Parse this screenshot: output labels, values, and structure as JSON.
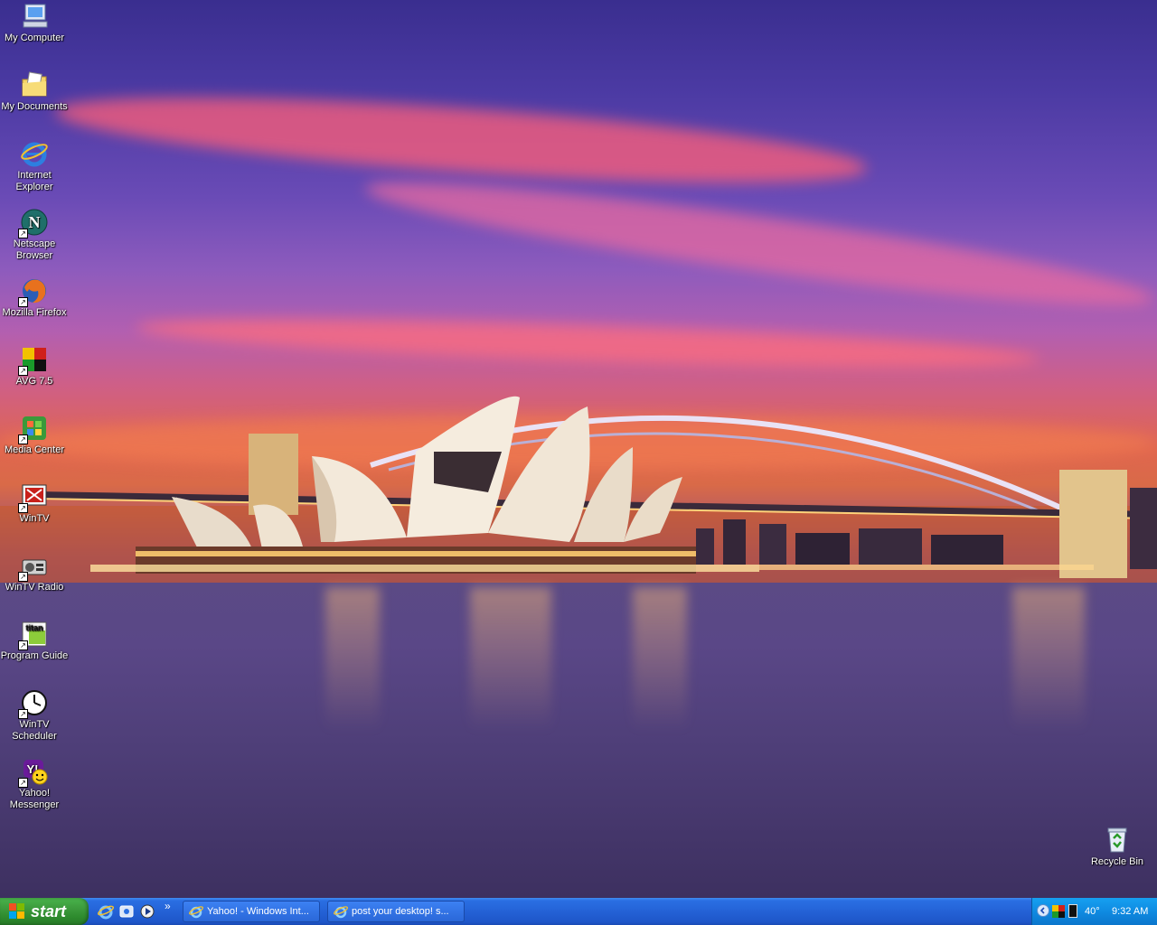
{
  "desktop_icons": [
    {
      "id": "my-computer",
      "label": "My Computer",
      "icon": "computer-icon"
    },
    {
      "id": "my-documents",
      "label": "My Documents",
      "icon": "documents-folder-icon"
    },
    {
      "id": "internet-explorer",
      "label": "Internet Explorer",
      "icon": "internet-explorer-icon"
    },
    {
      "id": "netscape-browser",
      "label": "Netscape Browser",
      "icon": "netscape-icon"
    },
    {
      "id": "mozilla-firefox",
      "label": "Mozilla Firefox",
      "icon": "firefox-icon"
    },
    {
      "id": "avg",
      "label": "AVG 7.5",
      "icon": "avg-icon"
    },
    {
      "id": "media-center",
      "label": "Media Center",
      "icon": "media-center-icon"
    },
    {
      "id": "wintv",
      "label": "WinTV",
      "icon": "wintv-icon"
    },
    {
      "id": "wintv-radio",
      "label": "WinTV Radio",
      "icon": "radio-icon"
    },
    {
      "id": "program-guide",
      "label": "Program Guide",
      "icon": "titan-tv-icon"
    },
    {
      "id": "wintv-scheduler",
      "label": "WinTV Scheduler",
      "icon": "clock-icon"
    },
    {
      "id": "yahoo-messenger",
      "label": "Yahoo! Messenger",
      "icon": "yahoo-messenger-icon"
    },
    {
      "id": "recycle-bin",
      "label": "Recycle Bin",
      "icon": "recycle-bin-icon"
    }
  ],
  "taskbar": {
    "start_label": "start",
    "chevron": "»",
    "tasks": [
      {
        "label": "Yahoo! - Windows Int...",
        "icon": "internet-explorer-icon"
      },
      {
        "label": "post your desktop! s...",
        "icon": "internet-explorer-icon"
      }
    ],
    "tray": {
      "temperature": "40°",
      "clock": "9:32 AM"
    }
  },
  "colors": {
    "taskbar_blue": "#2462d6",
    "start_green": "#3c9a3c",
    "tray_blue": "#0f8be2"
  }
}
